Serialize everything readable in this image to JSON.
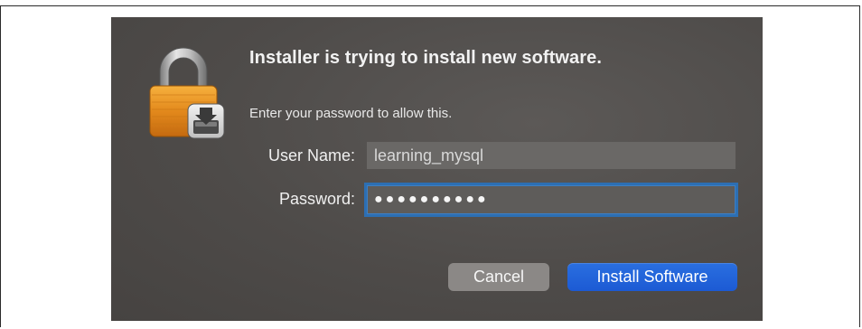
{
  "dialog": {
    "title": "Installer is trying to install new software.",
    "subtitle": "Enter your password to allow this.",
    "icon": "lock-installer-icon",
    "fields": {
      "user_name_label": "User Name:",
      "user_name_value": "learning_mysql",
      "password_label": "Password:",
      "password_mask": "●●●●●●●●●●"
    },
    "buttons": {
      "cancel_label": "Cancel",
      "install_label": "Install Software"
    },
    "colors": {
      "accent": "#1f62d9",
      "focus_ring": "#2d6fb3",
      "lock_body": "#e08a1e"
    }
  }
}
